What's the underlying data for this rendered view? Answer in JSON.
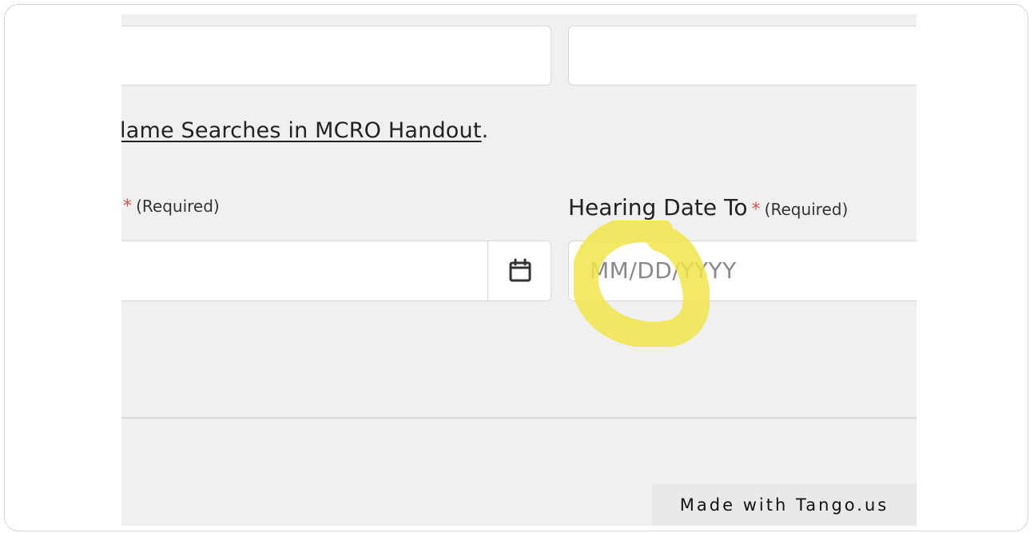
{
  "top_inputs": {
    "left_value": "",
    "right_value": ""
  },
  "handout": {
    "text": "lame Searches in MCRO Handout",
    "suffix": "."
  },
  "date_from": {
    "required_star": "*",
    "required_text": "(Required)",
    "value": ""
  },
  "date_to": {
    "label": "Hearing Date To",
    "required_star": "*",
    "required_text": "(Required)",
    "placeholder": "MM/DD/YYYY"
  },
  "calendar_button": {
    "icon": "calendar-icon"
  },
  "watermark": {
    "text": "Made with Tango.us"
  },
  "colors": {
    "required_star": "#d9534f",
    "highlight": "#f2e54a",
    "background": "#f0f0f0"
  }
}
